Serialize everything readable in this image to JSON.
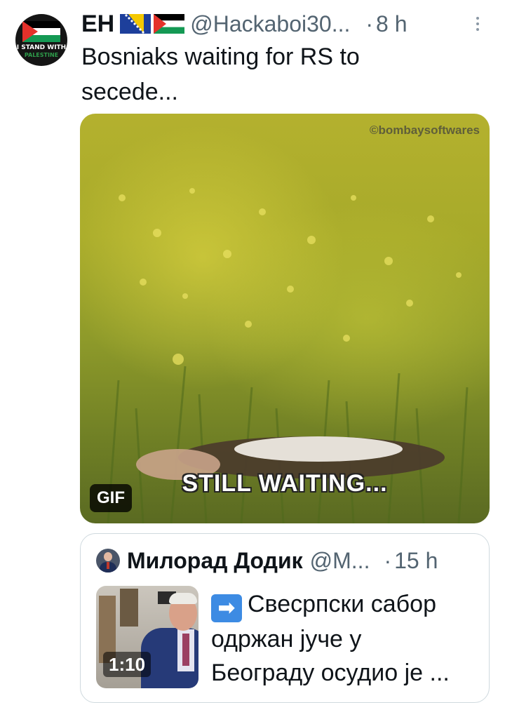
{
  "tweet": {
    "avatar_text": [
      "I STAND WITH",
      "PALESTINE"
    ],
    "display_name": "EH",
    "flags": [
      "bosnia-flag",
      "palestine-flag"
    ],
    "handle": "@Hackaboi30...",
    "dot": "·",
    "time": "8 h",
    "text_lines": [
      "Bosniaks waiting for RS to",
      "secede..."
    ],
    "media": {
      "watermark": "©bombaysoftwares",
      "caption": "STILL WAITING...",
      "badge": "GIF"
    }
  },
  "quote": {
    "display_name": "Милорад Додик",
    "handle": "@M...",
    "dot": "·",
    "time": "15 h",
    "thumb_duration": "1:10",
    "arrow_emoji": "➡",
    "text_lines": [
      "Свесрпски сабор",
      "одржан јуче у",
      "Београду осудио је ..."
    ]
  },
  "colors": {
    "text": "#0f1419",
    "secondary": "#536471",
    "border": "#cfd9de",
    "media_yellow": "#b4b12e"
  }
}
